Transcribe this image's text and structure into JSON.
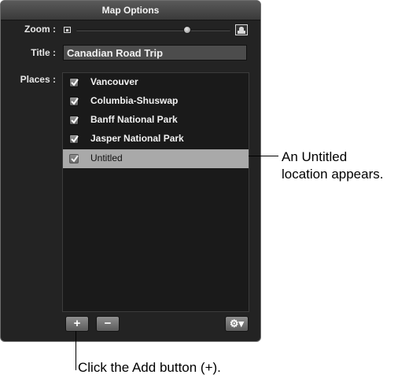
{
  "window": {
    "title": "Map Options"
  },
  "zoom": {
    "label": "Zoom :",
    "level": 0.72
  },
  "title_field": {
    "label": "Title :",
    "value": "Canadian Road Trip"
  },
  "places": {
    "label": "Places :",
    "items": [
      {
        "label": "Vancouver",
        "checked": true
      },
      {
        "label": "Columbia-Shuswap",
        "checked": true
      },
      {
        "label": "Banff National Park",
        "checked": true
      },
      {
        "label": "Jasper National Park",
        "checked": true
      },
      {
        "label": "Untitled",
        "checked": true,
        "selected": true
      }
    ]
  },
  "buttons": {
    "add": "+",
    "remove": "−",
    "action": "⚙▾"
  },
  "callouts": {
    "untitled_line1": "An Untitled",
    "untitled_line2": "location appears.",
    "add": "Click the Add button (+)."
  }
}
